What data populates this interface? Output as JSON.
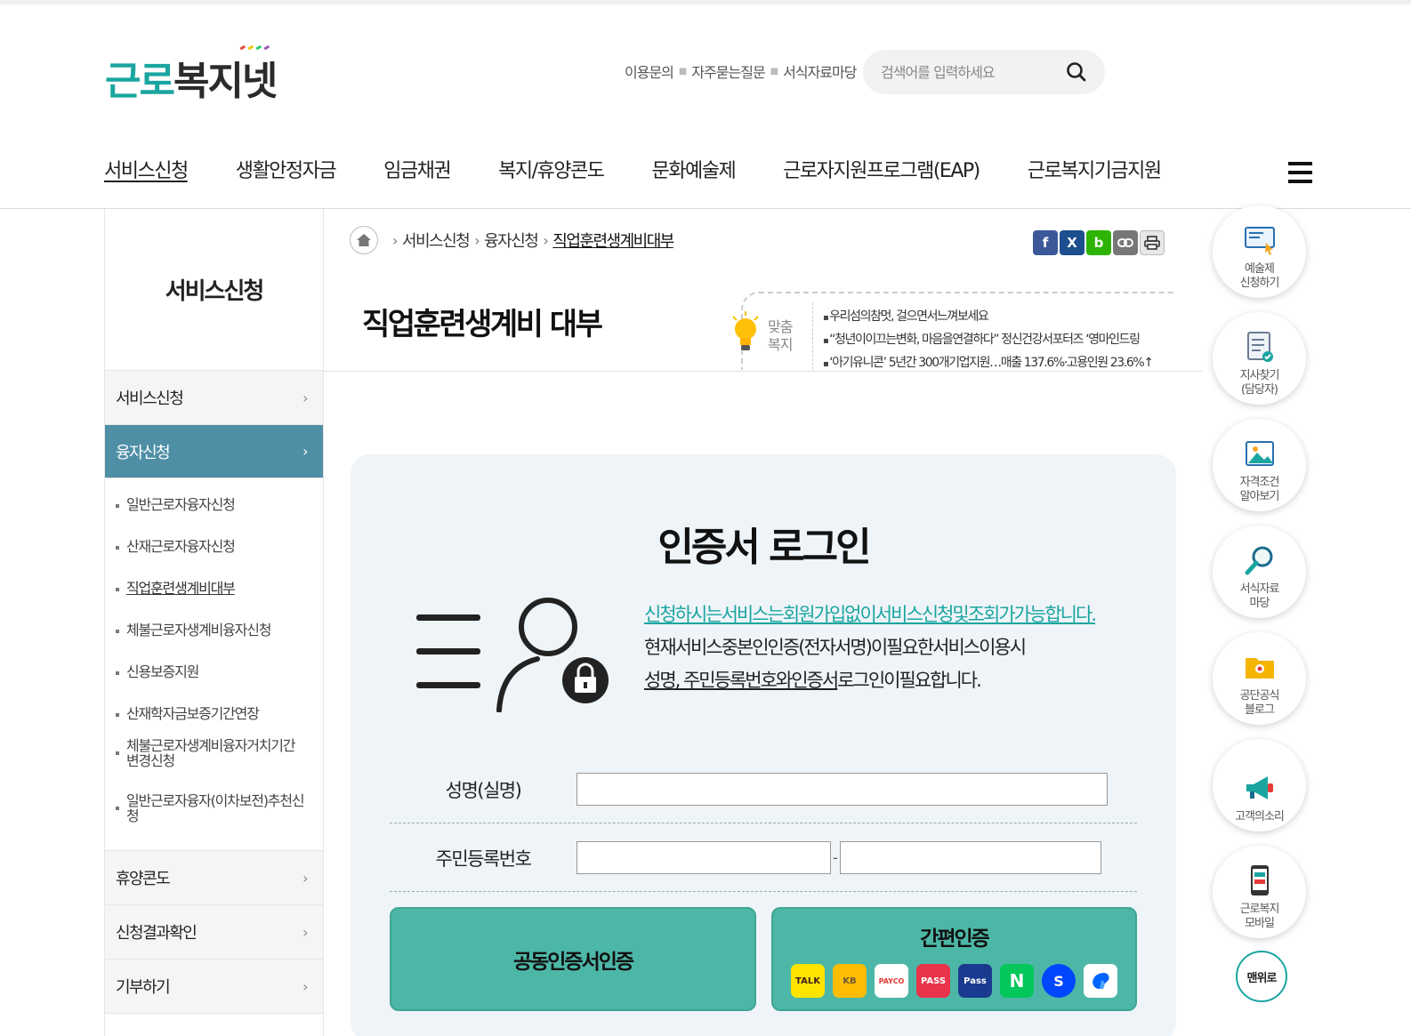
{
  "header": {
    "logo_part1": "근로",
    "logo_part2": "복지넷",
    "util_links": [
      "이용문의",
      "자주묻는질문",
      "서식자료마당"
    ],
    "search_placeholder": "검색어를 입력하세요"
  },
  "gnb": [
    "서비스신청",
    "생활안정자금",
    "임금채권",
    "복지/휴양콘도",
    "문화예술제",
    "근로자지원프로그램(EAP)",
    "근로복지기금지원"
  ],
  "lnb": {
    "title": "서비스신청",
    "items": [
      {
        "label": "서비스신청"
      },
      {
        "label": "융자신청"
      },
      {
        "label": "휴양콘도"
      },
      {
        "label": "신청결과확인"
      },
      {
        "label": "기부하기"
      }
    ],
    "subitems": [
      "일반근로자융자신청",
      "산재근로자융자신청",
      "직업훈련생계비대부",
      "체불근로자생계비융자신청",
      "신용보증지원",
      "산재학자금보증기간연장",
      "체불근로자생계비융자거치기간 변경신청",
      "일반근로자융자(이차보전)추천신청"
    ]
  },
  "breadcrumb": [
    "서비스신청",
    "융자신청",
    "직업훈련생계비대부"
  ],
  "share": {
    "fb": "f",
    "x": "X",
    "blog": "b"
  },
  "page_title": "직업훈련생계비 대부",
  "tips": {
    "label1": "맞춤",
    "label2": "복지",
    "items": [
      "우리섬의참멋, 걸으면서느껴보세요",
      "“청년이이끄는변화, 마음을연결하다” 정신건강서포터즈 ‘영마인드링",
      "‘아기유니콘’ 5년간 300개기업지원…매출 137.6%·고용인원 23.6%↑"
    ]
  },
  "login": {
    "title": "인증서 로그인",
    "notice_line1": "신청하시는서비스는회원가입없이서비스신청및조회가가능합니다.",
    "notice_line2": "현재서비스중본인인증(전자서명)이필요한서비스이용시",
    "notice_line3a": "성명, 주민등록번호와인증서",
    "notice_line3b": "로그인이필요합니다.",
    "name_label": "성명(실명)",
    "rrn_label": "주민등록번호",
    "rrn_dash": "-",
    "cert_button": "공동인증서인증",
    "easy_button": "간편인증",
    "easy_icons": [
      {
        "name": "kakao",
        "text": "TALK",
        "bg": "#fee500",
        "fg": "#3c1e1e"
      },
      {
        "name": "kb",
        "text": "KB",
        "bg": "#ffbc00",
        "fg": "#6b5a3a"
      },
      {
        "name": "payco",
        "text": "PAYCO",
        "bg": "#ffffff",
        "fg": "#e53935"
      },
      {
        "name": "pass",
        "text": "PASS",
        "bg": "#e8334a",
        "fg": "#ffffff"
      },
      {
        "name": "samsung-pass",
        "text": "Pass",
        "bg": "#1a3a8f",
        "fg": "#ffffff"
      },
      {
        "name": "naver",
        "text": "N",
        "bg": "#03c75a",
        "fg": "#ffffff"
      },
      {
        "name": "shinhan",
        "text": "S",
        "bg": "#0046ff",
        "fg": "#ffffff"
      },
      {
        "name": "toss",
        "text": "",
        "bg": "#ffffff",
        "fg": "#0064ff"
      }
    ]
  },
  "quick_menu": [
    {
      "label1": "예술제",
      "label2": "신청하기"
    },
    {
      "label1": "지사찾기",
      "label2": "(담당자)"
    },
    {
      "label1": "자격조건",
      "label2": "알아보기"
    },
    {
      "label1": "서식자료",
      "label2": "마당"
    },
    {
      "label1": "공단공식",
      "label2": "블로그"
    },
    {
      "label1": "고객의소리",
      "label2": ""
    },
    {
      "label1": "근로복지",
      "label2": "모바일"
    }
  ],
  "top_button": "맨위로",
  "colors": {
    "brand": "#1aa5a0",
    "lnb_active": "#4f8fa6",
    "button": "#4db7a7",
    "panel_bg": "#eff4f8"
  }
}
